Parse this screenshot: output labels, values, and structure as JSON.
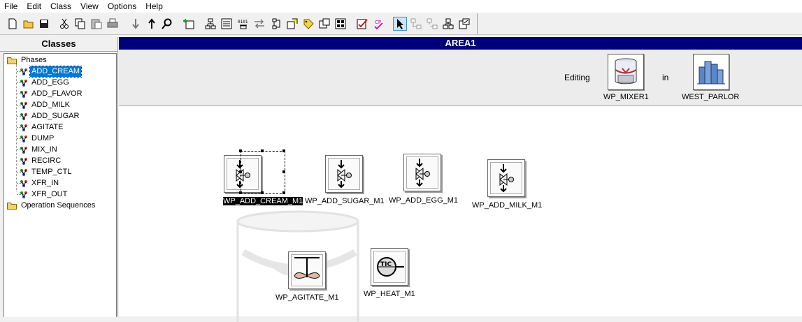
{
  "menu": [
    "File",
    "Edit",
    "Class",
    "View",
    "Options",
    "Help"
  ],
  "toolbar_icons": [
    "new-icon",
    "open-icon",
    "save-icon",
    "cut-icon",
    "copy-icon",
    "paste-icon",
    "print-icon",
    "move-down-icon",
    "move-up-icon",
    "find-icon",
    "add-object-icon",
    "hierarchy-icon",
    "properties-icon",
    "binary-icon",
    "swap-icon",
    "tree-icon",
    "assign-icon",
    "tag-icon",
    "module-icon",
    "library-icon",
    "edit-check-icon",
    "cp-icon",
    "pointer-icon",
    "link-icon",
    "unlink-icon",
    "network-icon",
    "export-icon"
  ],
  "classes": {
    "title": "Classes",
    "phases_label": "Phases",
    "phases": [
      "ADD_CREAM",
      "ADD_EGG",
      "ADD_FLAVOR",
      "ADD_MILK",
      "ADD_SUGAR",
      "AGITATE",
      "DUMP",
      "MIX_IN",
      "RECIRC",
      "TEMP_CTL",
      "XFR_IN",
      "XFR_OUT"
    ],
    "selected": "ADD_CREAM",
    "op_sequences_label": "Operation Sequences"
  },
  "area": {
    "title": "AREA1",
    "editing_label": "Editing",
    "in_label": "in",
    "unit_name": "WP_MIXER1",
    "cell_name": "WEST_PARLOR"
  },
  "blocks": [
    {
      "label": "WP_ADD_CREAM_M1",
      "icon": "valve-icon",
      "selected": true
    },
    {
      "label": "WP_ADD_SUGAR_M1",
      "icon": "valve-icon"
    },
    {
      "label": "WP_ADD_EGG_M1",
      "icon": "valve-icon"
    },
    {
      "label": "WP_ADD_MILK_M1",
      "icon": "valve-icon"
    },
    {
      "label": "WP_AGITATE_M1",
      "icon": "agitator-icon"
    },
    {
      "label": "WP_HEAT_M1",
      "icon": "tic-controller-icon"
    }
  ]
}
